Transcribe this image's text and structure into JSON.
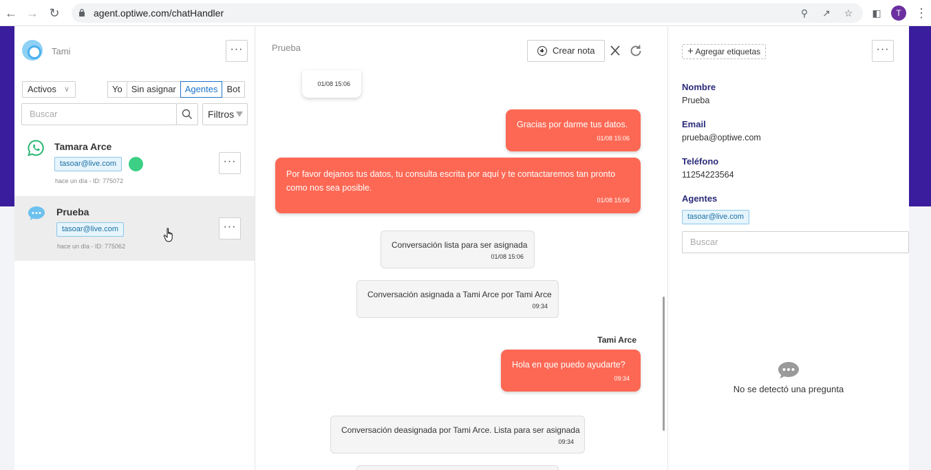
{
  "browser": {
    "url": "agent.optiwe.com/chatHandler",
    "profile_initial": "T"
  },
  "sidebar": {
    "agent_name": "Tami",
    "status_filter": "Activos",
    "assignment_filters": [
      "Yo",
      "Sin asignar",
      "Agentes",
      "Bot"
    ],
    "active_filter": "Agentes",
    "search_placeholder": "Buscar",
    "filters_label": "Filtros",
    "conversations": [
      {
        "name": "Tamara Arce",
        "channel": "whatsapp-icon",
        "tag": "tasoar@live.com",
        "online": true,
        "meta": "hace un día - ID: 775072",
        "selected": false
      },
      {
        "name": "Prueba",
        "channel": "webchat-icon",
        "tag": "tasoar@live.com",
        "online": false,
        "meta": "hace un día - ID: 775062",
        "selected": true
      }
    ]
  },
  "chat": {
    "title": "Prueba",
    "create_note_label": "Crear nota",
    "messages": [
      {
        "type": "in",
        "text": "",
        "time": "01/08 15:06"
      },
      {
        "type": "out",
        "text": "Gracias por darme tus datos.",
        "time": "01/08 15:06"
      },
      {
        "type": "out",
        "text": "Por favor dejanos tus datos, tu consulta escrita por aquí y te contactaremos tan pronto como nos sea posible.",
        "time": "01/08 15:06"
      },
      {
        "type": "system",
        "text": "Conversación lista para ser asignada",
        "time": "01/08 15:06"
      },
      {
        "type": "system",
        "text": "Conversación asignada a Tami Arce por Tami Arce",
        "time": "09:34"
      },
      {
        "type": "out",
        "sender": "Tami Arce",
        "text": "Hola en que puedo ayudarte?",
        "time": "09:34"
      },
      {
        "type": "system",
        "text": "Conversación deasignada por Tami Arce. Lista para ser asignada",
        "time": "09:34"
      }
    ]
  },
  "details": {
    "add_tags_label": "Agregar etiquetas",
    "fields": [
      {
        "label": "Nombre",
        "value": "Prueba"
      },
      {
        "label": "Email",
        "value": "prueba@optiwe.com"
      },
      {
        "label": "Teléfono",
        "value": "11254223564"
      }
    ],
    "agents_label": "Agentes",
    "agent_tag": "tasoar@live.com",
    "search_placeholder": "Buscar",
    "no_question_text": "No se detectó una pregunta"
  },
  "colors": {
    "brand_purple": "#3a1d9c",
    "outgoing_bubble": "#fd6854",
    "active_filter": "#1a73c9",
    "online_dot": "#3ccf85"
  }
}
